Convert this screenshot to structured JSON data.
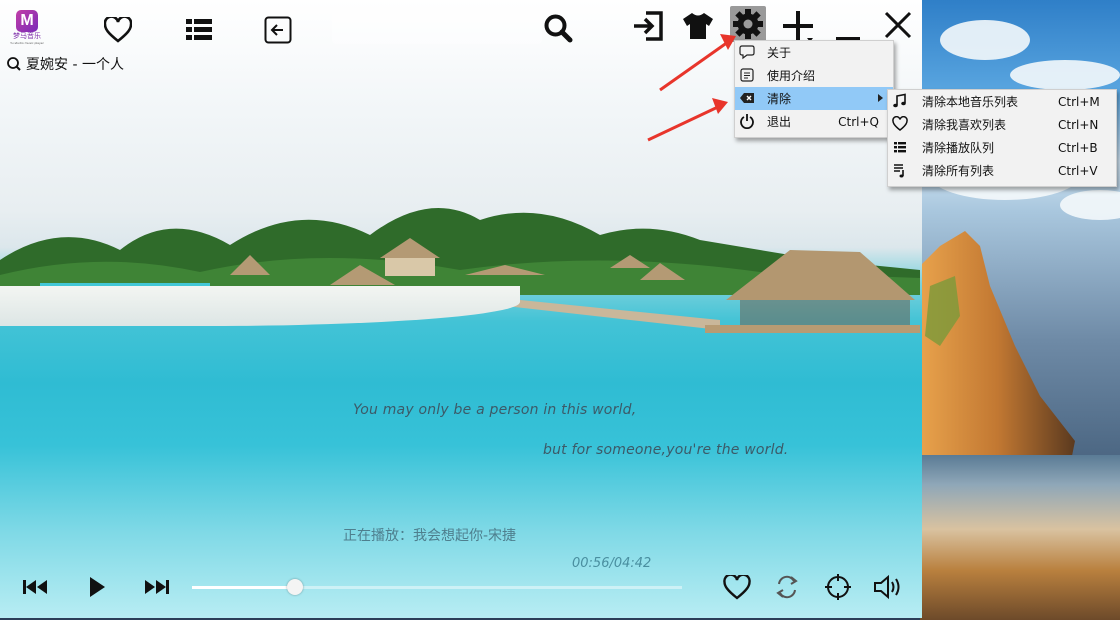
{
  "app": {
    "logo_text": "梦马音乐",
    "logo_letter": "M",
    "logo_subtext": "Yu studio music player"
  },
  "header": {
    "current_song": "夏婉安 - 一个人"
  },
  "settings_menu": {
    "items": [
      {
        "label": "关于",
        "icon": "speech-bubble-icon",
        "shortcut": ""
      },
      {
        "label": "使用介绍",
        "icon": "document-icon",
        "shortcut": ""
      },
      {
        "label": "清除",
        "icon": "clear-icon",
        "shortcut": "",
        "highlighted": true,
        "has_submenu": true
      },
      {
        "label": "退出",
        "icon": "power-icon",
        "shortcut": "Ctrl+Q"
      }
    ]
  },
  "clear_submenu": {
    "items": [
      {
        "label": "清除本地音乐列表",
        "icon": "music-note-icon",
        "shortcut": "Ctrl+M"
      },
      {
        "label": "清除我喜欢列表",
        "icon": "heart-icon",
        "shortcut": "Ctrl+N"
      },
      {
        "label": "清除播放队列",
        "icon": "list-icon",
        "shortcut": "Ctrl+B"
      },
      {
        "label": "清除所有列表",
        "icon": "playlist-icon",
        "shortcut": "Ctrl+V"
      }
    ]
  },
  "lyrics": {
    "line1": "You may only be a person in this world,",
    "line2": "but for someone,you're the world."
  },
  "player": {
    "now_playing": "正在播放：我会想起你-宋捷",
    "time": "00:56/04:42",
    "progress_fraction": 0.21
  },
  "colors": {
    "menu_highlight": "#91c9f7",
    "arrow_red": "#e8352b",
    "accent_logo": "#a03ab0"
  }
}
